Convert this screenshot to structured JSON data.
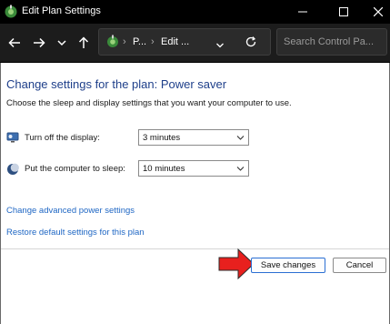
{
  "window": {
    "title": "Edit Plan Settings"
  },
  "address": {
    "crumb1": "P...",
    "separator": "›",
    "crumb2": "Edit ..."
  },
  "search": {
    "placeholder": "Search Control Pa..."
  },
  "content": {
    "heading": "Change settings for the plan: Power saver",
    "subtext": "Choose the sleep and display settings that you want your computer to use.",
    "display_label": "Turn off the display:",
    "display_value": "3 minutes",
    "sleep_label": "Put the computer to sleep:",
    "sleep_value": "10 minutes",
    "advanced_link": "Change advanced power settings",
    "restore_link": "Restore default settings for this plan"
  },
  "buttons": {
    "save": "Save changes",
    "cancel": "Cancel"
  },
  "colors": {
    "titlebar": "#000000",
    "nav": "#1c1c1c",
    "heading": "#1e3f8a",
    "link": "#1f67c4",
    "accent_arrow": "#e8201e"
  },
  "icons": [
    "control-panel-icon",
    "minimize-icon",
    "maximize-icon",
    "close-icon",
    "back-icon",
    "forward-icon",
    "history-dropdown-icon",
    "up-icon",
    "refresh-icon",
    "chevron-down-icon",
    "monitor-icon",
    "moon-icon"
  ]
}
